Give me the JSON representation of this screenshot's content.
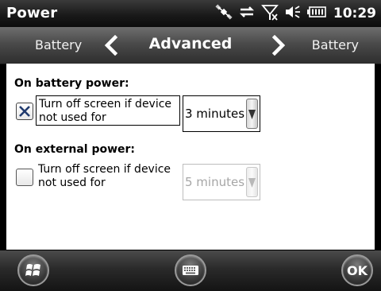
{
  "status_bar": {
    "title": "Power",
    "time": "10:29",
    "icons": [
      "satellite-icon",
      "sync-icon",
      "signal-off-icon",
      "speaker-icon",
      "battery-icon"
    ]
  },
  "tabs": {
    "prev": "Battery",
    "current": "Advanced",
    "next": "Battery"
  },
  "battery_section": {
    "heading": "On battery power:",
    "checkbox_checked": true,
    "option_line1": "Turn off screen if device",
    "option_line2": "not used for",
    "dropdown_value": "3 minutes",
    "enabled": true
  },
  "external_section": {
    "heading": "On external power:",
    "checkbox_checked": false,
    "option_line1": "Turn off screen if device",
    "option_line2": "not used for",
    "dropdown_value": "5 minutes",
    "enabled": false
  },
  "bottom_bar": {
    "start_icon": "windows-start-icon",
    "keyboard_icon": "keyboard-icon",
    "ok_label": "OK"
  }
}
